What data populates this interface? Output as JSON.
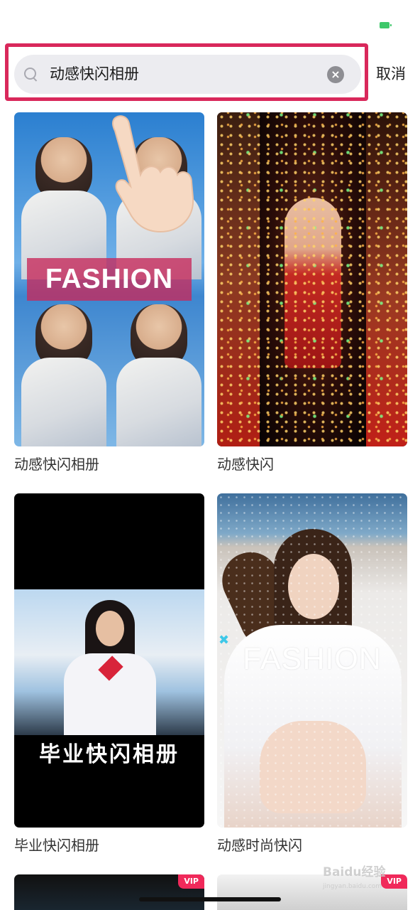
{
  "status_bar": {
    "battery_color": "#3ec86a"
  },
  "search": {
    "query": "动感快闪相册",
    "cancel_label": "取消",
    "highlight_color": "#d9285b"
  },
  "results": [
    {
      "title": "动感快闪相册",
      "overlay_text": "FASHION"
    },
    {
      "title": "动感快闪"
    },
    {
      "title": "毕业快闪相册",
      "overlay_text": "毕业快闪相册"
    },
    {
      "title": "动感时尚快闪",
      "overlay_text": "FASHION"
    },
    {
      "badge": "VIP"
    },
    {
      "badge": "VIP"
    }
  ],
  "watermark": {
    "brand": "Baidu经验",
    "url": "jingyan.baidu.com"
  },
  "colors": {
    "vip": "#f0295a",
    "accent": "#d9285b"
  }
}
